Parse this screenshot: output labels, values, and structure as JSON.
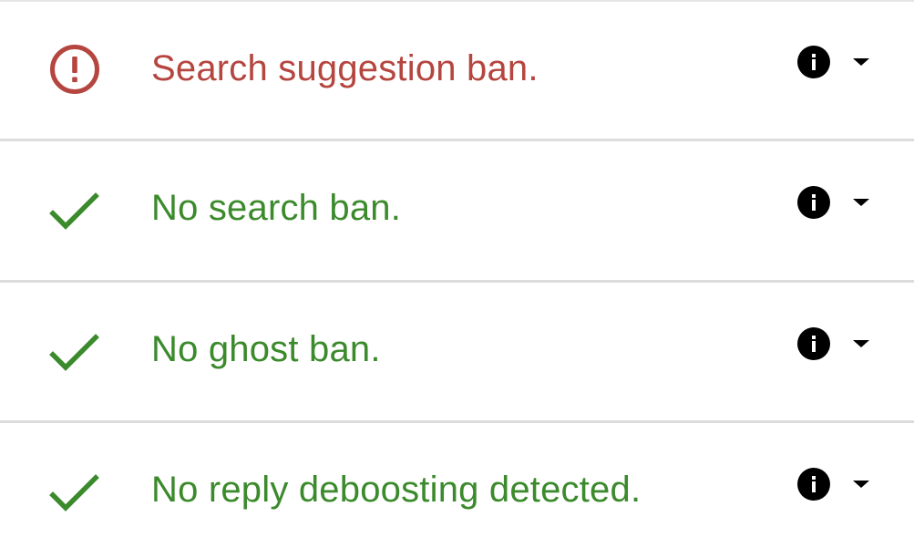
{
  "colors": {
    "error": "#b5453f",
    "success": "#3b8a2c",
    "icon_dark": "#000000",
    "divider": "#dcdcdc"
  },
  "results": [
    {
      "status": "error",
      "status_icon": "alert-circle-icon",
      "label": "Search suggestion ban.",
      "info_icon": "info-icon",
      "expand_icon": "caret-down-icon"
    },
    {
      "status": "success",
      "status_icon": "check-icon",
      "label": "No search ban.",
      "info_icon": "info-icon",
      "expand_icon": "caret-down-icon"
    },
    {
      "status": "success",
      "status_icon": "check-icon",
      "label": "No ghost ban.",
      "info_icon": "info-icon",
      "expand_icon": "caret-down-icon"
    },
    {
      "status": "success",
      "status_icon": "check-icon",
      "label": "No reply deboosting detected.",
      "info_icon": "info-icon",
      "expand_icon": "caret-down-icon"
    }
  ]
}
